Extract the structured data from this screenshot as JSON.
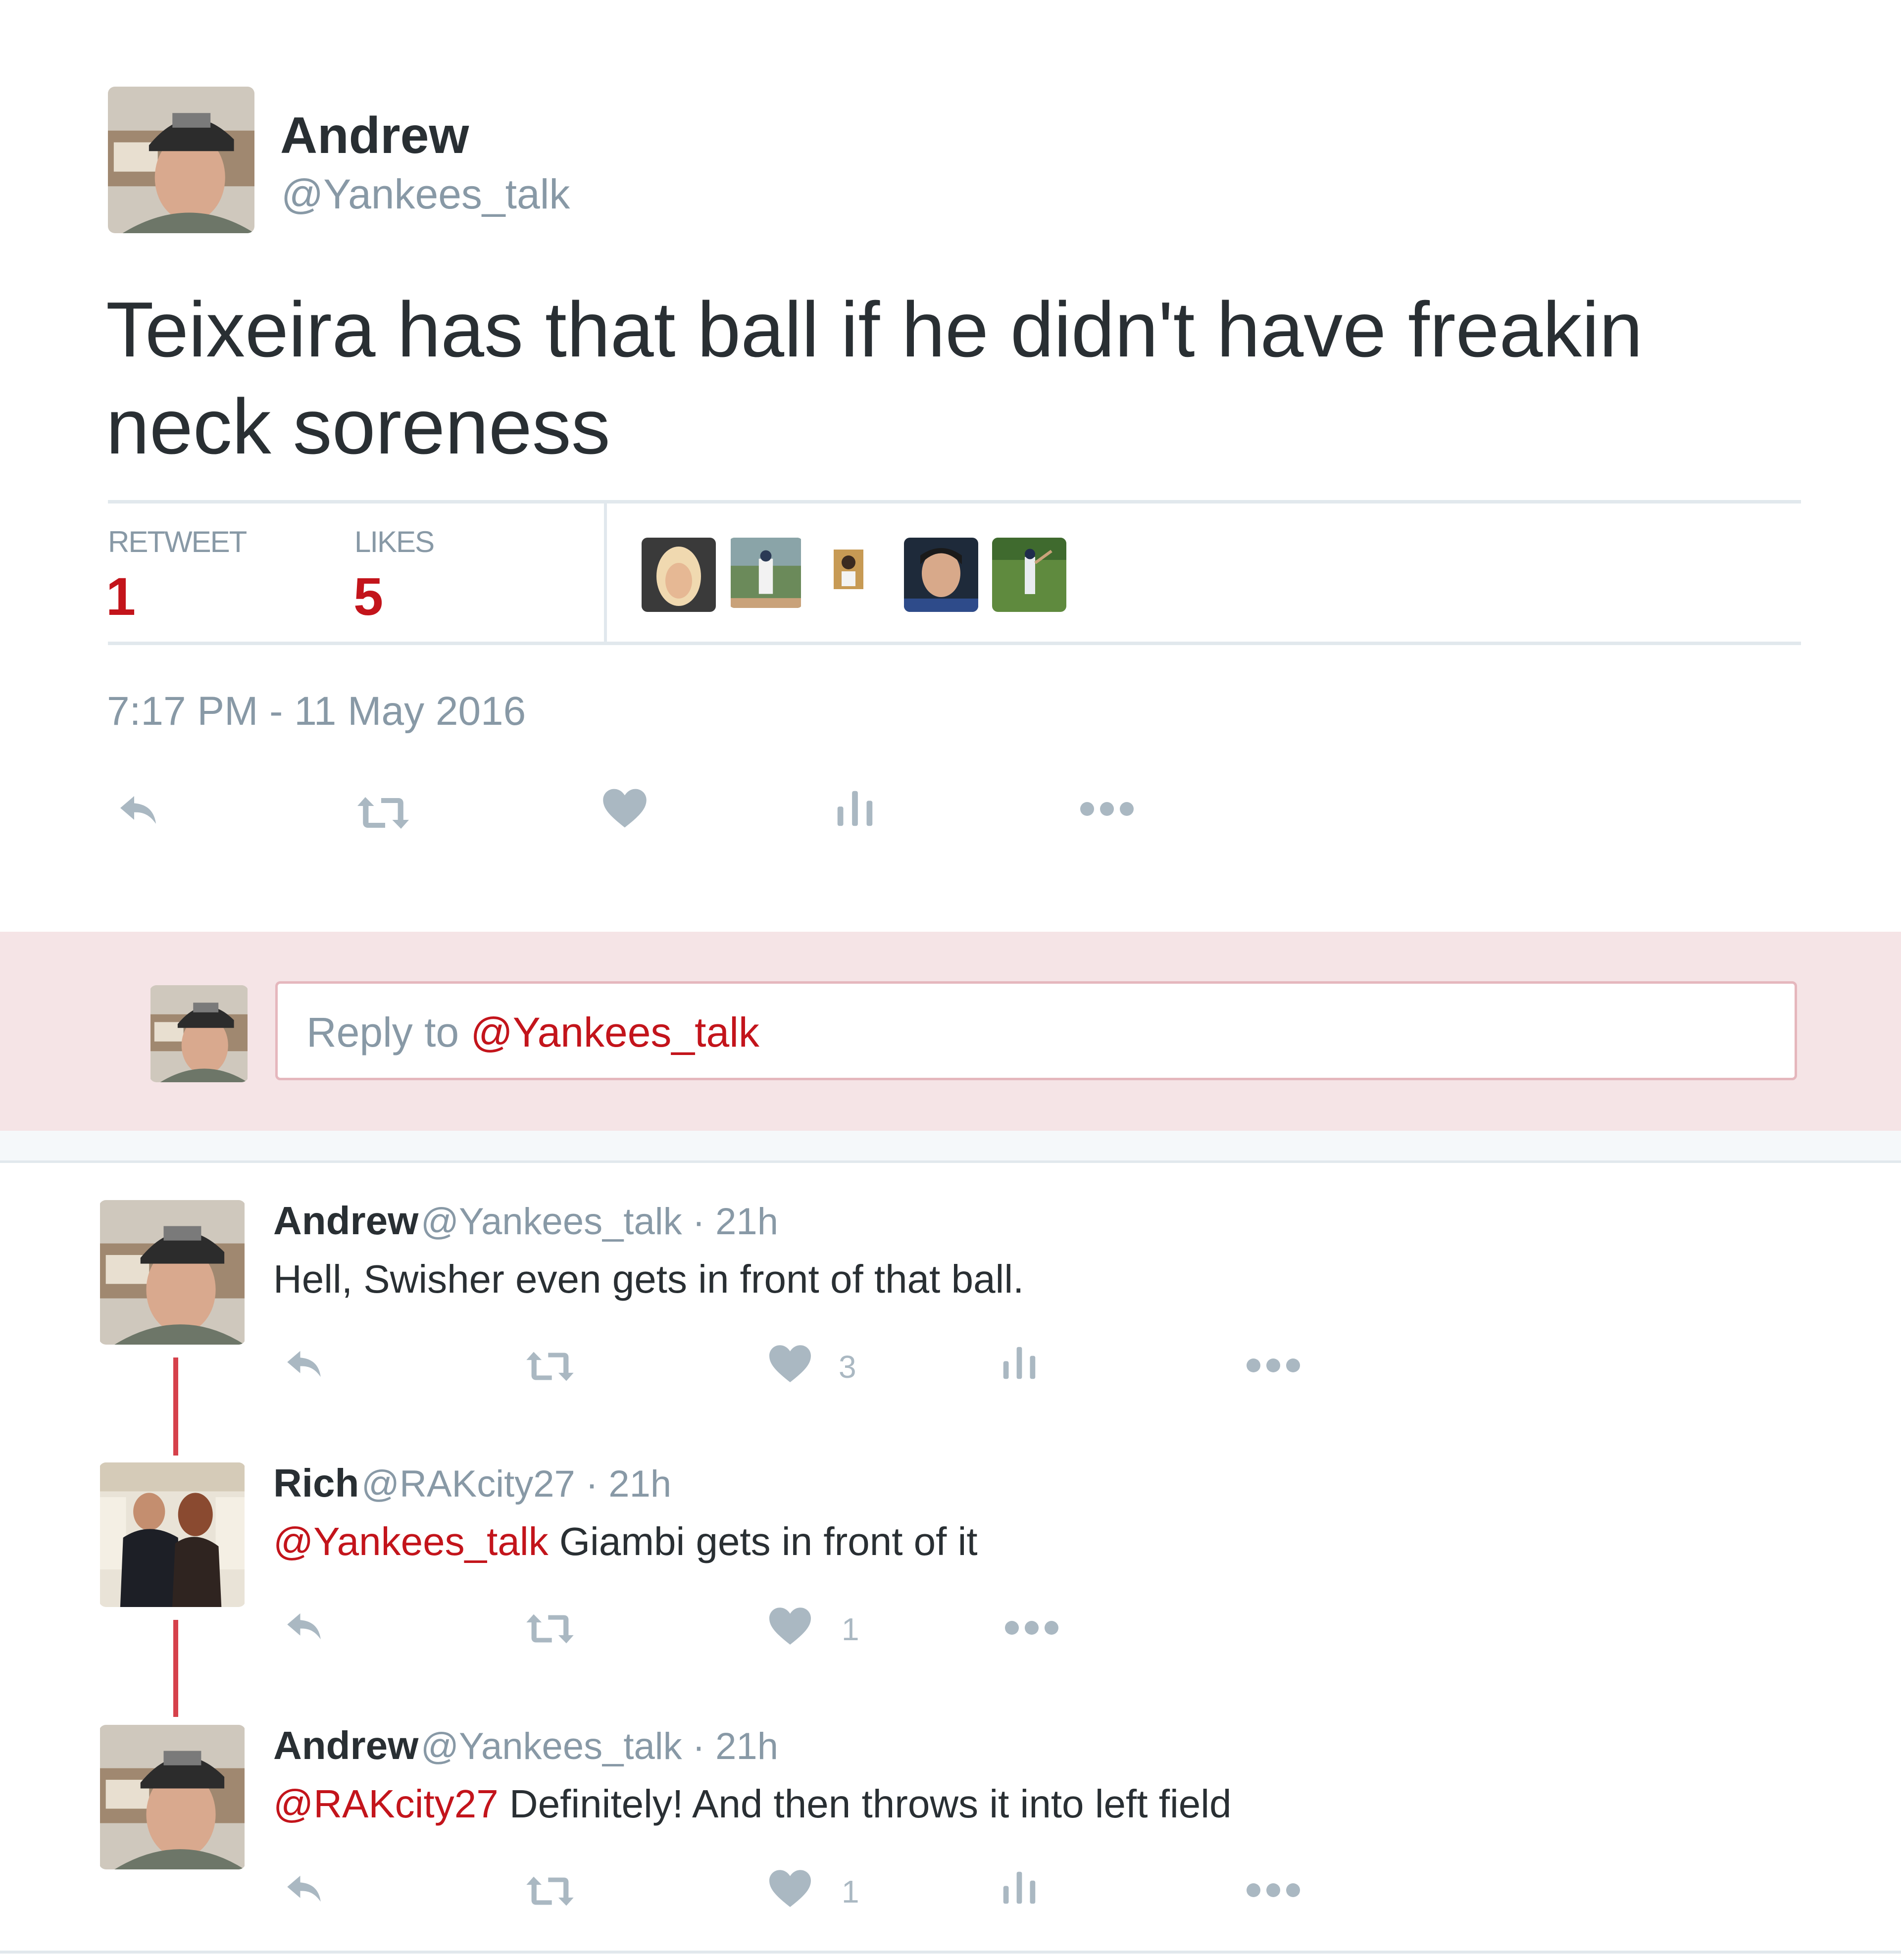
{
  "main_tweet": {
    "author_name": "Andrew",
    "author_handle": "@Yankees_talk",
    "text": "Teixeira has that ball if he didn't have freakin neck soreness",
    "stats": {
      "retweet_label": "RETWEET",
      "retweet_count": "1",
      "likes_label": "LIKES",
      "likes_count": "5"
    },
    "timestamp": "7:17 PM - 11 May 2016",
    "icons": [
      "reply-icon",
      "retweet-icon",
      "heart-icon",
      "analytics-icon",
      "more-icon"
    ]
  },
  "reply_box": {
    "prefix": "Reply to ",
    "mention": "@Yankees_talk"
  },
  "replies": [
    {
      "name": "Andrew",
      "meta": "@Yankees_talk · 21h",
      "mention": "",
      "text": "Hell, Swisher even gets in front of that ball.",
      "like_count": "3"
    },
    {
      "name": "Rich",
      "meta": "@RAKcity27 · 21h",
      "mention": "@Yankees_talk",
      "text": " Giambi gets in front of it",
      "like_count": "1"
    },
    {
      "name": "Andrew",
      "meta": "@Yankees_talk · 21h",
      "mention": "@RAKcity27",
      "text": " Definitely! And then throws it into left field",
      "like_count": "1"
    }
  ],
  "colors": {
    "accent": "#c3141b",
    "muted": "#8899a6",
    "icon": "#aab8c2",
    "reply_band": "#f5e4e6",
    "thread_line": "#d6414b"
  }
}
